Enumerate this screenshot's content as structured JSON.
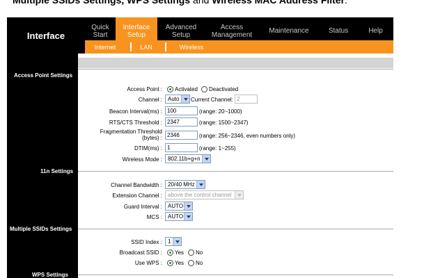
{
  "heading": {
    "part1": "Multiple SSIDs Settings",
    "part2": ", WPS Settings",
    "part3": " and ",
    "part4": "Wireless MAC Address Filter",
    "part5": "."
  },
  "nav": {
    "brand": "Interface",
    "tabs": [
      {
        "line1": "Quick",
        "line2": "Start"
      },
      {
        "line1": "Interface",
        "line2": "Setup"
      },
      {
        "line1": "Advanced",
        "line2": "Setup"
      },
      {
        "line1": "Access",
        "line2": "Management"
      },
      {
        "line1": "Maintenance",
        "line2": ""
      },
      {
        "line1": "Status",
        "line2": ""
      },
      {
        "line1": "Help",
        "line2": ""
      }
    ],
    "subtabs": [
      "Internet",
      "LAN",
      "Wireless"
    ]
  },
  "sections": {
    "ap": "Access Point Settings",
    "n11": "11n Settings",
    "mssid": "Multiple SSIDs Settings",
    "wps": "WPS Settings"
  },
  "ap": {
    "access_point_label": "Access Point :",
    "activated": "Activated",
    "deactivated": "Deactivated",
    "channel_label": "Channel :",
    "channel_value": "Auto",
    "current_channel_label": "Current Channel:",
    "current_channel_value": "2",
    "beacon_label": "Beacon Interval(ms) :",
    "beacon_value": "100",
    "beacon_range": "(range: 20~1000)",
    "rts_label": "RTS/CTS Threshold :",
    "rts_value": "2347",
    "rts_range": "(range: 1500~2347)",
    "frag_label1": "Fragmentation Threshold",
    "frag_label2": "(bytes) :",
    "frag_value": "2346",
    "frag_range": "(range: 256~2346, even numbers only)",
    "dtim_label": "DTIM(ms) :",
    "dtim_value": "1",
    "dtim_range": "(range: 1~255)",
    "mode_label": "Wireless Mode :",
    "mode_value": "802.11b+g+n"
  },
  "n11": {
    "bw_label": "Channel Bandwidth :",
    "bw_value": "20/40 MHz",
    "ext_label": "Extension Channel :",
    "ext_value": "above the control channel",
    "gi_label": "Guard Interval :",
    "gi_value": "AUTO",
    "mcs_label": "MCS :",
    "mcs_value": "AUTO"
  },
  "mssid": {
    "index_label": "SSID Index :",
    "index_value": "1",
    "broadcast_label": "Broadcast SSID :",
    "wps_label": "Use WPS :",
    "yes": "Yes",
    "no": "No"
  }
}
